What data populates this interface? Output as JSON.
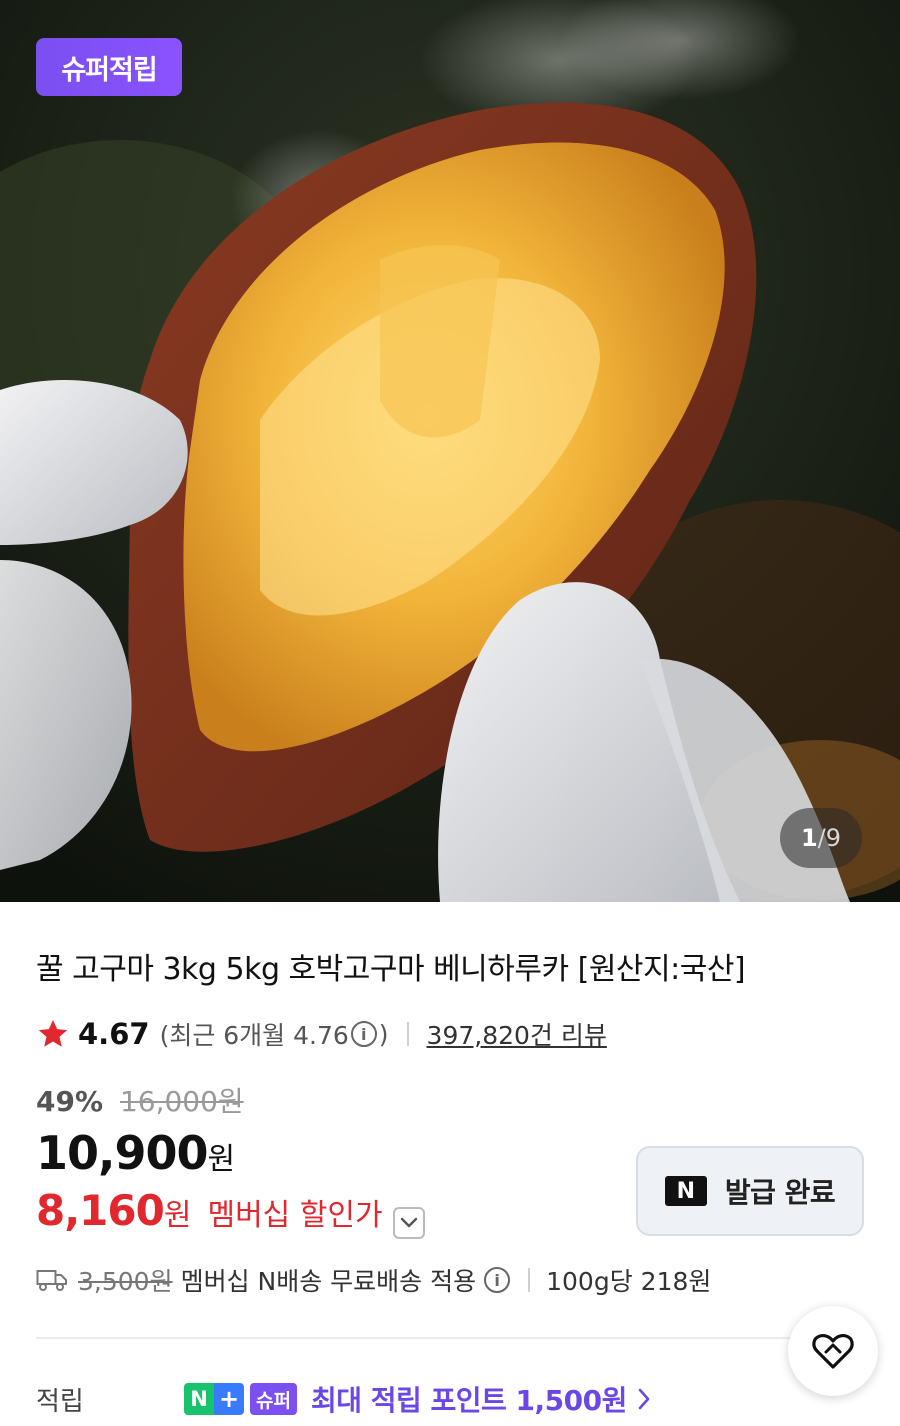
{
  "hero": {
    "badge": "슈퍼적립",
    "page_current": "1",
    "page_separator": "/",
    "page_total": "9",
    "image_icon": "roasted-sweet-potato-photo"
  },
  "product": {
    "title": "꿀 고구마 3kg 5kg 호박고구마 베니하루카 [원산지:국산]"
  },
  "rating": {
    "value": "4.67",
    "recent_prefix": "(최근 6개월 4.76",
    "recent_suffix": ")",
    "info_glyph": "i",
    "review_count": "397,820건 리뷰",
    "star_color": "#e0282e"
  },
  "price": {
    "discount_rate": "49%",
    "original": "16,000원",
    "sale_number": "10,900",
    "sale_unit": "원",
    "member_number": "8,160",
    "member_unit": "원",
    "member_label": "멤버십 할인가",
    "accent_color": "#e0282e"
  },
  "coupon": {
    "logo": "N",
    "label": "발급 완료"
  },
  "shipping": {
    "fee": "3,500원",
    "text": "멤버십 N배송 무료배송 적용",
    "unit_price": "100g당 218원"
  },
  "points": {
    "label": "적립",
    "n_badge": "N",
    "plus_badge": "+",
    "super_badge": "슈퍼",
    "text": "최대 적립 포인트 1,500원",
    "color": "#6b47e8"
  }
}
